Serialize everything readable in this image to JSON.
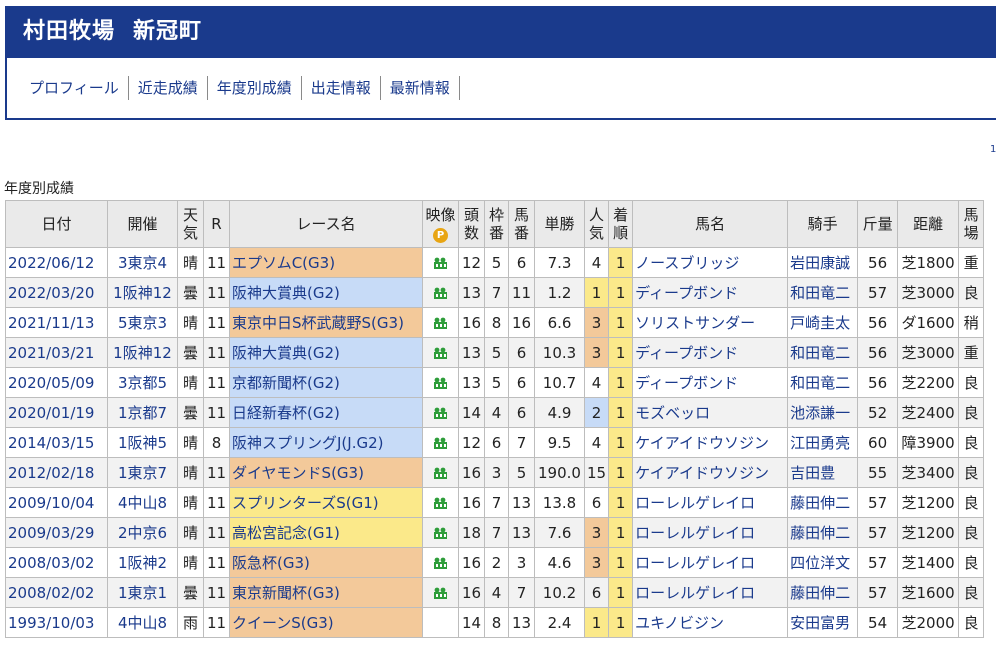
{
  "header": {
    "farm_name": "村田牧場",
    "town": "新冠町"
  },
  "nav": [
    "プロフィール",
    "近走成績",
    "年度別成績",
    "出走情報",
    "最新情報"
  ],
  "edge_mark": "1",
  "section_label": "年度別成績",
  "colors": {
    "brand": "#1a3a8c",
    "grade3": "#f3c99a",
    "grade2": "#c7dbf7",
    "grade1": "#fbe98a"
  },
  "table": {
    "headers": [
      "日付",
      "開催",
      "天気",
      "R",
      "レース名",
      "映像",
      "頭数",
      "枠番",
      "馬番",
      "単勝",
      "人気",
      "着順",
      "馬名",
      "騎手",
      "斤量",
      "距離",
      "馬場"
    ],
    "video_badge": "P",
    "rows": [
      {
        "date": "2022/06/12",
        "meet": "3東京4",
        "weather": "晴",
        "r": "11",
        "race": "エプソムC(G3)",
        "grade": "g3",
        "video": true,
        "heads": "12",
        "frame": "5",
        "num": "6",
        "odds": "7.3",
        "pop": "4",
        "pop_hl": "",
        "finish": "1",
        "horse": "ノースブリッジ",
        "jockey": "岩田康誠",
        "weight": "56",
        "dist": "芝1800",
        "track": "重"
      },
      {
        "date": "2022/03/20",
        "meet": "1阪神12",
        "weather": "曇",
        "r": "11",
        "race": "阪神大賞典(G2)",
        "grade": "g2",
        "video": true,
        "heads": "13",
        "frame": "7",
        "num": "11",
        "odds": "1.2",
        "pop": "1",
        "pop_hl": "hl",
        "finish": "1",
        "horse": "ディープボンド",
        "jockey": "和田竜二",
        "weight": "57",
        "dist": "芝3000",
        "track": "良"
      },
      {
        "date": "2021/11/13",
        "meet": "5東京3",
        "weather": "晴",
        "r": "11",
        "race": "東京中日S杯武蔵野S(G3)",
        "grade": "g3",
        "video": true,
        "heads": "16",
        "frame": "8",
        "num": "16",
        "odds": "6.6",
        "pop": "3",
        "pop_hl": "pk",
        "finish": "1",
        "horse": "ソリストサンダー",
        "jockey": "戸崎圭太",
        "weight": "56",
        "dist": "ダ1600",
        "track": "稍"
      },
      {
        "date": "2021/03/21",
        "meet": "1阪神12",
        "weather": "曇",
        "r": "11",
        "race": "阪神大賞典(G2)",
        "grade": "g2",
        "video": true,
        "heads": "13",
        "frame": "5",
        "num": "6",
        "odds": "10.3",
        "pop": "3",
        "pop_hl": "pk",
        "finish": "1",
        "horse": "ディープボンド",
        "jockey": "和田竜二",
        "weight": "56",
        "dist": "芝3000",
        "track": "重"
      },
      {
        "date": "2020/05/09",
        "meet": "3京都5",
        "weather": "晴",
        "r": "11",
        "race": "京都新聞杯(G2)",
        "grade": "g2",
        "video": true,
        "heads": "13",
        "frame": "5",
        "num": "6",
        "odds": "10.7",
        "pop": "4",
        "pop_hl": "",
        "finish": "1",
        "horse": "ディープボンド",
        "jockey": "和田竜二",
        "weight": "56",
        "dist": "芝2200",
        "track": "良"
      },
      {
        "date": "2020/01/19",
        "meet": "1京都7",
        "weather": "曇",
        "r": "11",
        "race": "日経新春杯(G2)",
        "grade": "g2",
        "video": true,
        "heads": "14",
        "frame": "4",
        "num": "6",
        "odds": "4.9",
        "pop": "2",
        "pop_hl": "bl",
        "finish": "1",
        "horse": "モズベッロ",
        "jockey": "池添謙一",
        "weight": "52",
        "dist": "芝2400",
        "track": "良"
      },
      {
        "date": "2014/03/15",
        "meet": "1阪神5",
        "weather": "晴",
        "r": "8",
        "race": "阪神スプリングJ(J.G2)",
        "grade": "g2",
        "video": true,
        "heads": "12",
        "frame": "6",
        "num": "7",
        "odds": "9.5",
        "pop": "4",
        "pop_hl": "",
        "finish": "1",
        "horse": "ケイアイドウソジン",
        "jockey": "江田勇亮",
        "weight": "60",
        "dist": "障3900",
        "track": "良"
      },
      {
        "date": "2012/02/18",
        "meet": "1東京7",
        "weather": "晴",
        "r": "11",
        "race": "ダイヤモンドS(G3)",
        "grade": "g3",
        "video": true,
        "heads": "16",
        "frame": "3",
        "num": "5",
        "odds": "190.0",
        "pop": "15",
        "pop_hl": "",
        "finish": "1",
        "horse": "ケイアイドウソジン",
        "jockey": "吉田豊",
        "weight": "55",
        "dist": "芝3400",
        "track": "良"
      },
      {
        "date": "2009/10/04",
        "meet": "4中山8",
        "weather": "晴",
        "r": "11",
        "race": "スプリンターズS(G1)",
        "grade": "g1",
        "video": true,
        "heads": "16",
        "frame": "7",
        "num": "13",
        "odds": "13.8",
        "pop": "6",
        "pop_hl": "",
        "finish": "1",
        "horse": "ローレルゲレイロ",
        "jockey": "藤田伸二",
        "weight": "57",
        "dist": "芝1200",
        "track": "良"
      },
      {
        "date": "2009/03/29",
        "meet": "2中京6",
        "weather": "晴",
        "r": "11",
        "race": "高松宮記念(G1)",
        "grade": "g1",
        "video": true,
        "heads": "18",
        "frame": "7",
        "num": "13",
        "odds": "7.6",
        "pop": "3",
        "pop_hl": "pk",
        "finish": "1",
        "horse": "ローレルゲレイロ",
        "jockey": "藤田伸二",
        "weight": "57",
        "dist": "芝1200",
        "track": "良"
      },
      {
        "date": "2008/03/02",
        "meet": "1阪神2",
        "weather": "晴",
        "r": "11",
        "race": "阪急杯(G3)",
        "grade": "g3",
        "video": true,
        "heads": "16",
        "frame": "2",
        "num": "3",
        "odds": "4.6",
        "pop": "3",
        "pop_hl": "pk",
        "finish": "1",
        "horse": "ローレルゲレイロ",
        "jockey": "四位洋文",
        "weight": "57",
        "dist": "芝1400",
        "track": "良"
      },
      {
        "date": "2008/02/02",
        "meet": "1東京1",
        "weather": "曇",
        "r": "11",
        "race": "東京新聞杯(G3)",
        "grade": "g3",
        "video": true,
        "heads": "16",
        "frame": "4",
        "num": "7",
        "odds": "10.2",
        "pop": "6",
        "pop_hl": "",
        "finish": "1",
        "horse": "ローレルゲレイロ",
        "jockey": "藤田伸二",
        "weight": "57",
        "dist": "芝1600",
        "track": "良"
      },
      {
        "date": "1993/10/03",
        "meet": "4中山8",
        "weather": "雨",
        "r": "11",
        "race": "クイーンS(G3)",
        "grade": "g3",
        "video": false,
        "heads": "14",
        "frame": "8",
        "num": "13",
        "odds": "2.4",
        "pop": "1",
        "pop_hl": "hl",
        "finish": "1",
        "horse": "ユキノビジン",
        "jockey": "安田富男",
        "weight": "54",
        "dist": "芝2000",
        "track": "良"
      }
    ]
  }
}
